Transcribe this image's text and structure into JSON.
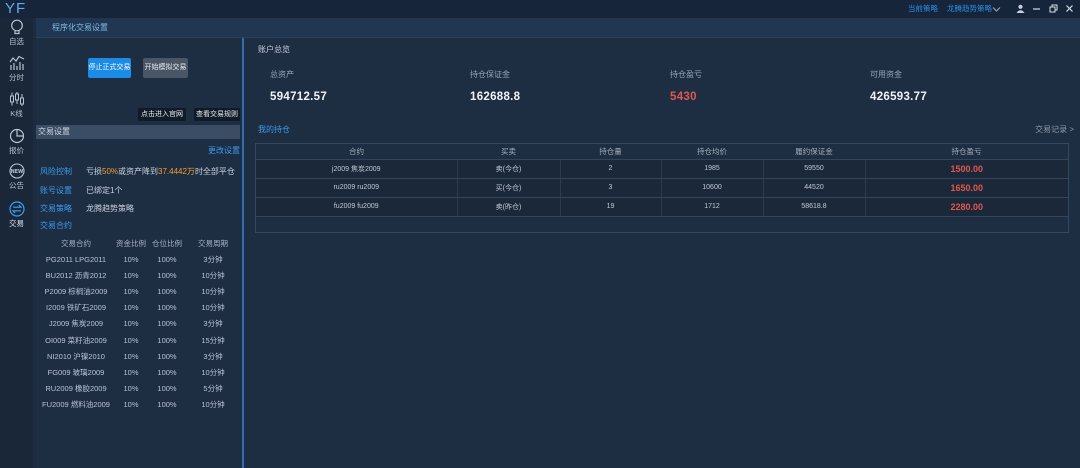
{
  "app": {
    "logo": "YF"
  },
  "topbar": {
    "strategy_label": "当前策略",
    "strategy_value": "龙腾趋势策略"
  },
  "sidebar": {
    "items": [
      {
        "label": "自选",
        "icon": "lightbulb-icon"
      },
      {
        "label": "分时",
        "icon": "intraday-chart-icon"
      },
      {
        "label": "K线",
        "icon": "candlestick-icon"
      },
      {
        "label": "报价",
        "icon": "pie-chart-icon"
      },
      {
        "label": "公告",
        "icon": "new-badge-icon",
        "badge": "NEW"
      },
      {
        "label": "交易",
        "icon": "exchange-icon",
        "active": true
      }
    ]
  },
  "page": {
    "title": "程序化交易设置"
  },
  "controls": {
    "stop_live": "停止正式交易",
    "start_sim": "开始模拟交易",
    "official_site": "点击进入官网",
    "view_rules": "查看交易规则"
  },
  "settings": {
    "header": "交易设置",
    "edit": "更改设置",
    "risk": {
      "label": "风险控制",
      "prefix": "亏损",
      "loss_pct": "50%",
      "middle": "或资产降到",
      "threshold": "37.4442万",
      "suffix": "时全部平仓"
    },
    "account": {
      "label": "账号设置",
      "value": "已绑定1个"
    },
    "strategy": {
      "label": "交易策略",
      "value": "龙腾趋势策略"
    },
    "contracts": {
      "label": "交易合约",
      "columns": [
        "交易合约",
        "资金比例",
        "仓位比例",
        "交易周期"
      ],
      "rows": [
        {
          "contract": "PG2011 LPG2011",
          "fund_ratio": "10%",
          "position_ratio": "100%",
          "period": "3分钟"
        },
        {
          "contract": "BU2012 沥青2012",
          "fund_ratio": "10%",
          "position_ratio": "100%",
          "period": "10分钟"
        },
        {
          "contract": "P2009 棕榈油2009",
          "fund_ratio": "10%",
          "position_ratio": "100%",
          "period": "10分钟"
        },
        {
          "contract": "I2009 铁矿石2009",
          "fund_ratio": "10%",
          "position_ratio": "100%",
          "period": "10分钟"
        },
        {
          "contract": "J2009 焦炭2009",
          "fund_ratio": "10%",
          "position_ratio": "100%",
          "period": "3分钟"
        },
        {
          "contract": "OI009 菜籽油2009",
          "fund_ratio": "10%",
          "position_ratio": "100%",
          "period": "15分钟"
        },
        {
          "contract": "NI2010 沪镍2010",
          "fund_ratio": "10%",
          "position_ratio": "100%",
          "period": "3分钟"
        },
        {
          "contract": "FG009 玻璃2009",
          "fund_ratio": "10%",
          "position_ratio": "100%",
          "period": "10分钟"
        },
        {
          "contract": "RU2009 橡胶2009",
          "fund_ratio": "10%",
          "position_ratio": "100%",
          "period": "5分钟"
        },
        {
          "contract": "FU2009 燃料油2009",
          "fund_ratio": "10%",
          "position_ratio": "100%",
          "period": "10分钟"
        }
      ]
    }
  },
  "overview": {
    "title": "账户总览",
    "stats": [
      {
        "label": "总资产",
        "value": "594712.57"
      },
      {
        "label": "持仓保证金",
        "value": "162688.8"
      },
      {
        "label": "持仓盈亏",
        "value": "5430"
      },
      {
        "label": "可用资金",
        "value": "426593.77"
      }
    ]
  },
  "holdings": {
    "title": "我的持仓",
    "records_link": "交易记录 >",
    "columns": [
      "合约",
      "买卖",
      "持仓量",
      "持仓均价",
      "履约保证金",
      "持仓盈亏"
    ],
    "rows": [
      {
        "contract": "j2009 焦炭2009",
        "side": "卖(今仓)",
        "qty": "2",
        "avg_price": "1985",
        "margin": "59550",
        "pnl": "1500.00"
      },
      {
        "contract": "ru2009 ru2009",
        "side": "买(今仓)",
        "qty": "3",
        "avg_price": "10600",
        "margin": "44520",
        "pnl": "1650.00"
      },
      {
        "contract": "fu2009 fu2009",
        "side": "卖(昨仓)",
        "qty": "19",
        "avg_price": "1712",
        "margin": "58618.8",
        "pnl": "2280.00"
      }
    ]
  },
  "colors": {
    "background": "#1c2b3f",
    "accent": "#1b8be6",
    "link": "#3d9cf0",
    "loss_red": "#e2574c",
    "highlight_orange": "#f0a030"
  }
}
